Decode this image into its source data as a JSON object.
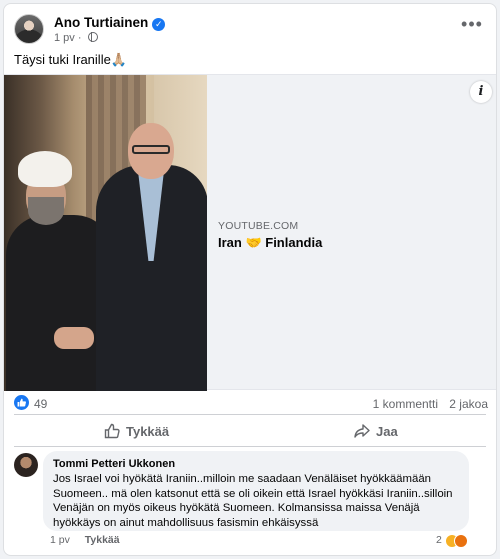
{
  "post": {
    "author": "Ano Turtiainen",
    "timestamp": "1 pv",
    "text": "Täysi tuki Iranille🙏🏼",
    "more_icon": "•••"
  },
  "link_preview": {
    "source": "YOUTUBE.COM",
    "title": "Iran 🤝 Finlandia",
    "info_icon": "i"
  },
  "stats": {
    "likes": "49",
    "comments": "1 kommentti",
    "shares": "2 jakoa"
  },
  "actions": {
    "like_label": "Tykkää",
    "share_label": "Jaa"
  },
  "comment": {
    "author": "Tommi Petteri Ukkonen",
    "text": "Jos Israel voi hyökätä Iraniin..milloin me saadaan Venäläiset hyökkäämään Suomeen.. mä olen katsonut että se oli oikein että Israel hyökkäsi Iraniin..silloin Venäjän on myös oikeus hyökätä Suomeen. Kolmansissa maissa Venäjä hyökkäys on ainut mahdollisuus fasismin ehkäisyssä",
    "timestamp": "1 pv",
    "like_label": "Tykkää",
    "reaction_count": "2"
  },
  "colors": {
    "accent": "#1877f2",
    "muted_text": "#65676b",
    "bubble": "#f0f2f5"
  }
}
